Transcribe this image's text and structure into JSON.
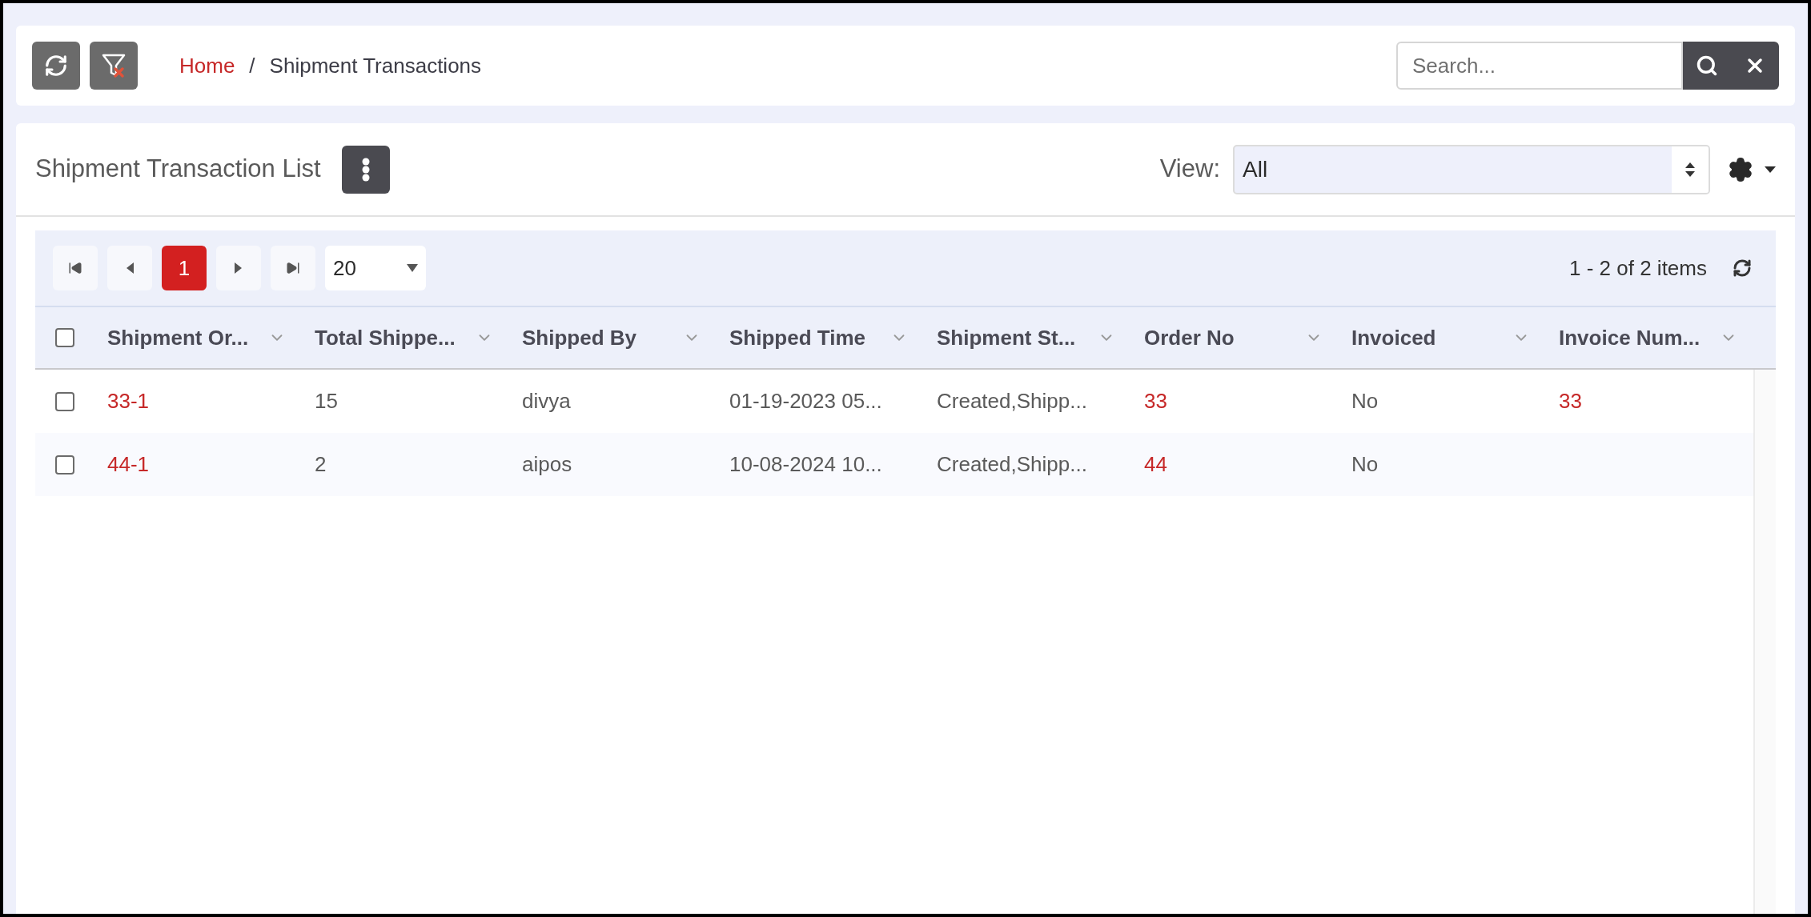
{
  "toolbar": {
    "buttons": [
      {
        "kind": "refresh"
      },
      {
        "kind": "clear-filter"
      }
    ]
  },
  "breadcrumb_separator": "/",
  "breadcrumb": [
    {
      "label": "Home",
      "kind": "link"
    },
    {
      "label": "Shipment Transactions",
      "kind": "current"
    }
  ],
  "search": {
    "placeholder": "Search..."
  },
  "list": {
    "title": "Shipment Transaction List",
    "view_label": "View:",
    "view_value": "All"
  },
  "pager": {
    "nav": [
      {
        "kind": "first"
      },
      {
        "kind": "prev"
      }
    ],
    "pages": [
      {
        "label": "1",
        "selected": true
      }
    ],
    "nav_after": [
      {
        "kind": "next"
      },
      {
        "kind": "last"
      }
    ],
    "page_size": "20",
    "items_info": "1 - 2 of 2 items"
  },
  "table": {
    "select_all": {
      "checked": false
    },
    "columns": [
      "Shipment Or...",
      "Total Shippe...",
      "Shipped By",
      "Shipped Time",
      "Shipment St...",
      "Order No",
      "Invoiced",
      "Invoice Num..."
    ],
    "rows": [
      {
        "checked": false,
        "cells": [
          {
            "text": "33-1",
            "kind": "link"
          },
          {
            "text": "15",
            "kind": "text"
          },
          {
            "text": "divya",
            "kind": "text"
          },
          {
            "text": "01-19-2023 05...",
            "kind": "text"
          },
          {
            "text": "Created,Shipp...",
            "kind": "text"
          },
          {
            "text": "33",
            "kind": "link"
          },
          {
            "text": "No",
            "kind": "text"
          },
          {
            "text": "33",
            "kind": "link"
          }
        ]
      },
      {
        "checked": false,
        "cells": [
          {
            "text": "44-1",
            "kind": "link"
          },
          {
            "text": "2",
            "kind": "text"
          },
          {
            "text": "aipos",
            "kind": "text"
          },
          {
            "text": "10-08-2024 10...",
            "kind": "text"
          },
          {
            "text": "Created,Shipp...",
            "kind": "text"
          },
          {
            "text": "44",
            "kind": "link"
          },
          {
            "text": "No",
            "kind": "text"
          },
          null
        ]
      }
    ]
  }
}
